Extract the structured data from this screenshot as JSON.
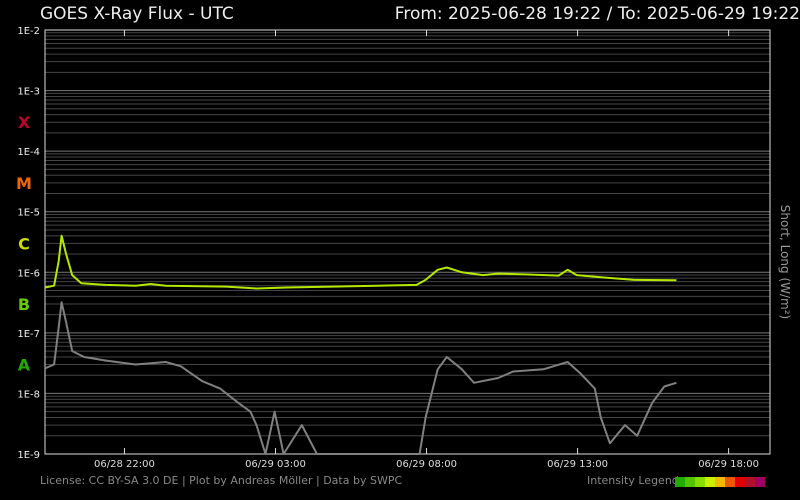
{
  "header": {
    "title": "GOES X-Ray Flux - UTC",
    "range": "From: 2025-06-28 19:22  /  To: 2025-06-29 19:22"
  },
  "footer": {
    "license": "License: CC BY-SA 3.0 DE | Plot by Andreas Möller | Data by SWPC",
    "legend_label": "Intensity Legend",
    "legend_colors": [
      "#22aa00",
      "#55c400",
      "#88dd00",
      "#ccee00",
      "#f5b800",
      "#ee5500",
      "#e00000",
      "#b0102a",
      "#a00060"
    ]
  },
  "chart_data": {
    "type": "line",
    "title": "GOES X-Ray Flux - UTC",
    "ylabel": "Short, Long (W/m²)",
    "yscale": "log",
    "ylim": [
      1e-09,
      0.01
    ],
    "xlim_hours": [
      0,
      24
    ],
    "x_unit": "hours since 2025-06-28 19:22 UTC",
    "ytick_labels": [
      "1E-2",
      "1E-3",
      "1E-4",
      "1E-5",
      "1E-6",
      "1E-7",
      "1E-8",
      "1E-9"
    ],
    "xtick_labels": [
      {
        "label": "06/28 22:00",
        "h": 2.63
      },
      {
        "label": "06/29 03:00",
        "h": 7.63
      },
      {
        "label": "06/29 08:00",
        "h": 12.63
      },
      {
        "label": "06/29 13:00",
        "h": 17.63
      },
      {
        "label": "06/29 18:00",
        "h": 22.63
      }
    ],
    "classes": [
      {
        "label": "X",
        "color": "#c0002a",
        "flux": 0.0003
      },
      {
        "label": "M",
        "color": "#ee6600",
        "flux": 3e-05
      },
      {
        "label": "C",
        "color": "#ccdd00",
        "flux": 3e-06
      },
      {
        "label": "B",
        "color": "#66cc00",
        "flux": 3e-07
      },
      {
        "label": "A",
        "color": "#22aa00",
        "flux": 3e-08
      }
    ],
    "grid": true,
    "series": [
      {
        "name": "Long",
        "color": "#b5e800",
        "points": [
          [
            0,
            5.6e-07
          ],
          [
            0.3,
            6e-07
          ],
          [
            0.45,
            1.5e-06
          ],
          [
            0.55,
            4e-06
          ],
          [
            0.7,
            2e-06
          ],
          [
            0.9,
            9e-07
          ],
          [
            1.2,
            6.6e-07
          ],
          [
            2,
            6.2e-07
          ],
          [
            3,
            6e-07
          ],
          [
            3.5,
            6.4e-07
          ],
          [
            4,
            6e-07
          ],
          [
            6,
            5.8e-07
          ],
          [
            7,
            5.4e-07
          ],
          [
            8,
            5.6e-07
          ],
          [
            9.5,
            5.8e-07
          ],
          [
            11,
            6e-07
          ],
          [
            12.3,
            6.2e-07
          ],
          [
            12.6,
            7.5e-07
          ],
          [
            13,
            1.1e-06
          ],
          [
            13.3,
            1.2e-06
          ],
          [
            13.8,
            1e-06
          ],
          [
            14.5,
            9e-07
          ],
          [
            15,
            9.5e-07
          ],
          [
            16,
            9.2e-07
          ],
          [
            17,
            8.8e-07
          ],
          [
            17.3,
            1.1e-06
          ],
          [
            17.6,
            9e-07
          ],
          [
            18.5,
            8.2e-07
          ],
          [
            19.5,
            7.5e-07
          ],
          [
            20.9,
            7.4e-07
          ]
        ]
      },
      {
        "name": "Short",
        "color": "#808080",
        "points": [
          [
            0,
            2.6e-08
          ],
          [
            0.3,
            3e-08
          ],
          [
            0.45,
            1.2e-07
          ],
          [
            0.55,
            3.2e-07
          ],
          [
            0.7,
            1.5e-07
          ],
          [
            0.9,
            5e-08
          ],
          [
            1.3,
            4e-08
          ],
          [
            2,
            3.5e-08
          ],
          [
            3,
            3e-08
          ],
          [
            4,
            3.3e-08
          ],
          [
            4.5,
            2.8e-08
          ],
          [
            5.2,
            1.6e-08
          ],
          [
            5.8,
            1.2e-08
          ],
          [
            6.4,
            7e-09
          ],
          [
            6.8,
            5e-09
          ],
          [
            7,
            3e-09
          ],
          [
            7.3,
            1e-09
          ],
          [
            7.6,
            5e-09
          ],
          [
            7.9,
            1e-09
          ],
          [
            8.5,
            3e-09
          ],
          [
            9,
            1e-09
          ],
          [
            12.4,
            1e-09
          ],
          [
            12.6,
            4e-09
          ],
          [
            13,
            2.5e-08
          ],
          [
            13.3,
            4e-08
          ],
          [
            13.8,
            2.5e-08
          ],
          [
            14.2,
            1.5e-08
          ],
          [
            15,
            1.8e-08
          ],
          [
            15.5,
            2.3e-08
          ],
          [
            16.5,
            2.5e-08
          ],
          [
            17.3,
            3.3e-08
          ],
          [
            17.7,
            2.2e-08
          ],
          [
            18.2,
            1.2e-08
          ],
          [
            18.4,
            4e-09
          ],
          [
            18.7,
            1.5e-09
          ],
          [
            19.2,
            3e-09
          ],
          [
            19.6,
            2e-09
          ],
          [
            20.1,
            7e-09
          ],
          [
            20.5,
            1.3e-08
          ],
          [
            20.9,
            1.5e-08
          ]
        ]
      }
    ]
  }
}
